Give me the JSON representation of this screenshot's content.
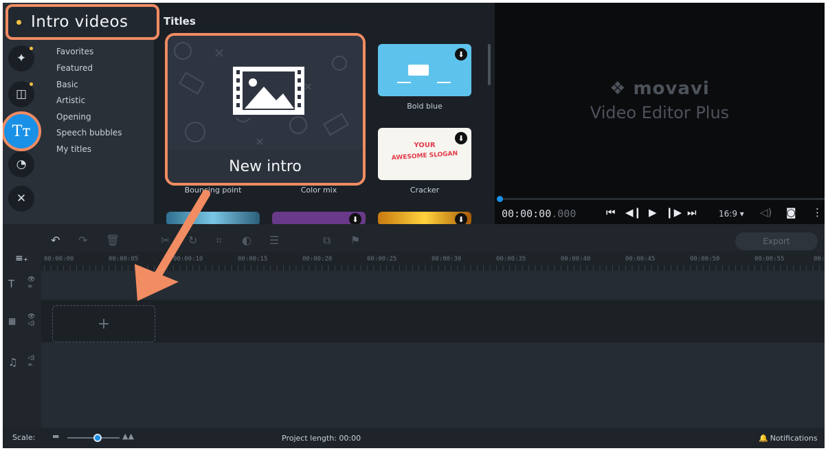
{
  "highlight_tag": {
    "label": "Intro videos"
  },
  "sidebar": {
    "icons": [
      {
        "name": "magic-wand-icon",
        "glyph": "✦"
      },
      {
        "name": "transitions-icon",
        "glyph": "◫"
      },
      {
        "name": "titles-icon",
        "glyph": "Tт"
      },
      {
        "name": "stickers-icon",
        "glyph": "◔"
      },
      {
        "name": "tools-icon",
        "glyph": "✕"
      }
    ]
  },
  "categories": [
    "Favorites",
    "Featured",
    "Basic",
    "Artistic",
    "Opening",
    "Speech bubbles",
    "My titles"
  ],
  "gallery": {
    "section_title": "Titles",
    "new_intro_label": "New intro",
    "items": [
      {
        "label": "Bold blue"
      },
      {
        "label": "Cracker",
        "text1": "YOUR",
        "text2": "AWESOME SLOGAN"
      },
      {
        "label": "Bouncing point"
      },
      {
        "label": "Color mix"
      }
    ]
  },
  "player": {
    "brand": "movavi",
    "product": "Video Editor Plus",
    "time_main": "00:00:00",
    "time_ms": ".000",
    "aspect_ratio": "16:9"
  },
  "timeline": {
    "export_label": "Export",
    "ruler": [
      "00:00:00",
      "00:00:05",
      "00:00:10",
      "00:00:15",
      "00:00:20",
      "00:00:25",
      "00:00:30",
      "00:00:35",
      "00:00:40",
      "00:00:45",
      "00:00:50",
      "00:00:55",
      "00:0"
    ],
    "dropzone_symbol": "+"
  },
  "status": {
    "scale_label": "Scale:",
    "project_length": "Project length: 00:00",
    "notifications": "Notifications"
  },
  "colors": {
    "accent": "#1a91e6",
    "highlight": "#f28c62",
    "badge": "#f5c242"
  }
}
